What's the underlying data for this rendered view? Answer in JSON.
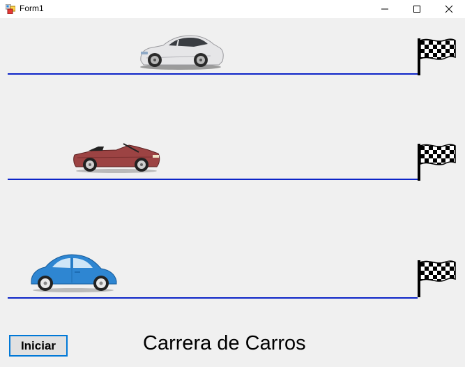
{
  "window": {
    "title": "Form1",
    "icon": "winforms-app-icon",
    "controls": [
      "minimize-icon",
      "maximize-icon",
      "close-icon"
    ]
  },
  "tracks": [
    {
      "car": "white-sports-car",
      "flag": "checkered-flag-icon",
      "line_color": "#0c24c8"
    },
    {
      "car": "red-convertible-car",
      "flag": "checkered-flag-icon",
      "line_color": "#0c24c8"
    },
    {
      "car": "blue-beetle-car",
      "flag": "checkered-flag-icon",
      "line_color": "#0c24c8"
    }
  ],
  "controls": {
    "start_label": "Iniciar"
  },
  "heading": "Carrera de Carros",
  "colors": {
    "background": "#f0f0f0",
    "track_line": "#0c24c8",
    "button_border": "#0078d7",
    "white_car": "#e8e8ea",
    "red_car": "#9a4444",
    "blue_car": "#2e87d3"
  }
}
